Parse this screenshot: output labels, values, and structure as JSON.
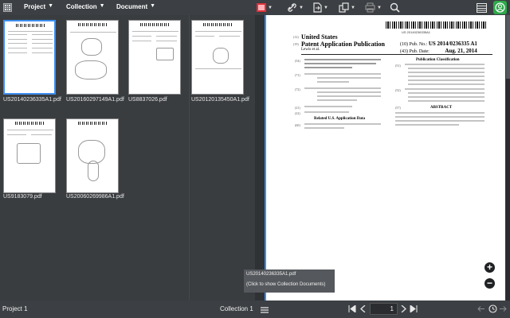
{
  "toolbar": {
    "menus": [
      {
        "label": "Project"
      },
      {
        "label": "Collection"
      },
      {
        "label": "Document"
      }
    ],
    "accent_color": "#3d8eef",
    "tools": [
      "select-region-icon",
      "link-icon",
      "export-icon",
      "copy-icon",
      "print-icon",
      "search-icon"
    ],
    "right_icons": [
      "table-icon",
      "account-icon"
    ]
  },
  "thumbnails": [
    {
      "name": "US20140236335A1.pdf",
      "selected": true
    },
    {
      "name": "US20160297149A1.pdf",
      "selected": false
    },
    {
      "name": "US8837026.pdf",
      "selected": false
    },
    {
      "name": "US20120135450A1.pdf",
      "selected": false
    },
    {
      "name": "US9183079.pdf",
      "selected": false
    },
    {
      "name": "US20060269986A1.pdf",
      "selected": false
    }
  ],
  "document": {
    "barcode_number": "US 20140236335A1",
    "country": "United States",
    "pub_type": "Patent Application Publication",
    "inventor": "Lewis et al.",
    "pub_no_label": "(10) Pub. No.:",
    "pub_no": "US 2014/0236335 A1",
    "pub_date_label": "(43) Pub. Date:",
    "pub_date": "Aug. 21, 2014",
    "classification_heading": "Publication Classification",
    "abstract_heading": "ABSTRACT",
    "related_heading": "Related U.S. Application Data"
  },
  "tooltip": {
    "line1": "US20140236335A1.pdf",
    "line2": "(Click to show Collection Documents)"
  },
  "status": {
    "project": "Project 1",
    "collection": "Collection 1",
    "page": "1"
  }
}
